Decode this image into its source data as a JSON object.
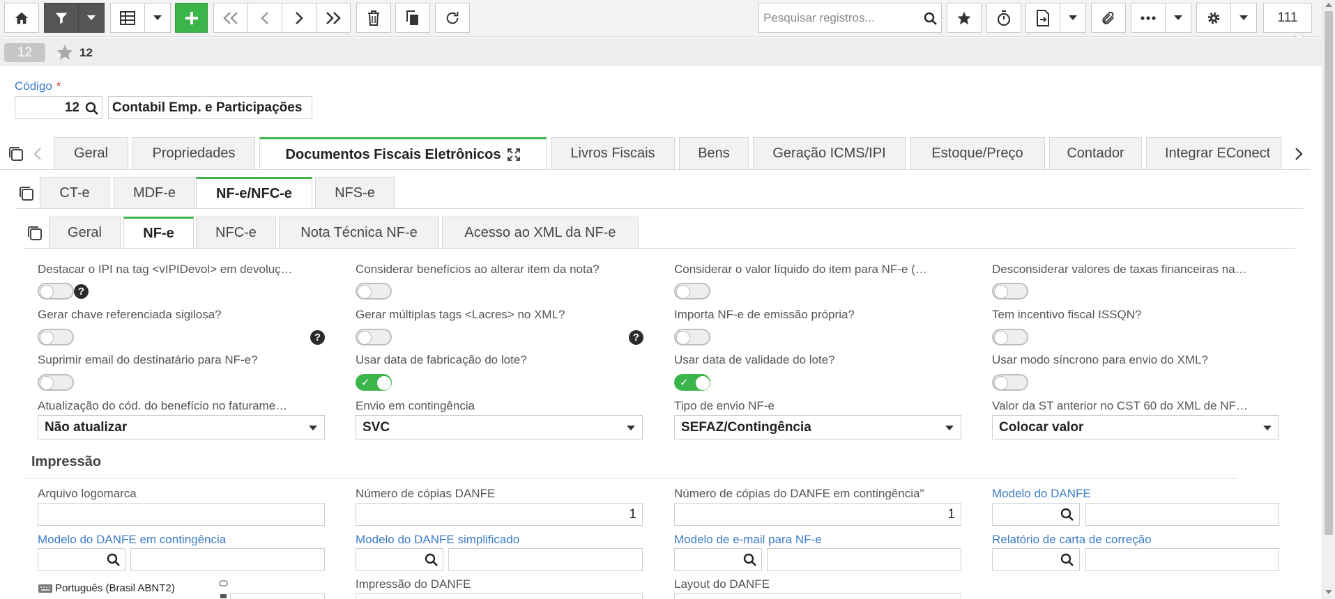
{
  "toolbar": {
    "search_placeholder": "Pesquisar registros...",
    "record_count": "111",
    "icons": [
      "home-icon",
      "filter-icon",
      "grid-icon",
      "plus-icon",
      "first-icon",
      "prev-icon",
      "next-icon",
      "last-icon",
      "trash-icon",
      "copy-icon",
      "refresh-icon",
      "search-icon",
      "star-icon",
      "timer-icon",
      "export-icon",
      "attach-icon",
      "more-icon",
      "gear-icon"
    ]
  },
  "subbar": {
    "record_badge": "12",
    "fav_number": "12"
  },
  "header": {
    "code_label": "Código",
    "code_value": "12",
    "company_name": "Contabil Emp. e Participações"
  },
  "main_tabs": [
    {
      "label": "Geral"
    },
    {
      "label": "Propriedades"
    },
    {
      "label": "Documentos Fiscais Eletrônicos",
      "active": true
    },
    {
      "label": "Livros Fiscais"
    },
    {
      "label": "Bens"
    },
    {
      "label": "Geração ICMS/IPI"
    },
    {
      "label": "Estoque/Preço"
    },
    {
      "label": "Contador"
    },
    {
      "label": "Integrar EConect"
    }
  ],
  "doc_tabs": [
    {
      "label": "CT-e"
    },
    {
      "label": "MDF-e"
    },
    {
      "label": "NF-e/NFC-e",
      "active": true
    },
    {
      "label": "NFS-e"
    }
  ],
  "nfe_tabs": [
    {
      "label": "Geral"
    },
    {
      "label": "NF-e",
      "active": true
    },
    {
      "label": "NFC-e"
    },
    {
      "label": "Nota Técnica NF-e"
    },
    {
      "label": "Acesso ao XML da NF-e"
    }
  ],
  "toggles": [
    {
      "label": "Destacar o IPI na tag <vIPIDevol> em devoluç…",
      "on": false,
      "help": true
    },
    {
      "label": "Considerar benefícios ao alterar item da nota?",
      "on": false
    },
    {
      "label": "Considerar o valor líquido do item para NF-e (…",
      "on": false
    },
    {
      "label": "Desconsiderar valores de taxas financeiras na…",
      "on": false
    },
    {
      "label": "Gerar chave referenciada sigilosa?",
      "on": false,
      "help": true
    },
    {
      "label": "Gerar múltiplas tags <Lacres> no XML?",
      "on": false,
      "help": true
    },
    {
      "label": "Importa NF-e de emissão própria?",
      "on": false
    },
    {
      "label": "Tem incentivo fiscal ISSQN?",
      "on": false
    },
    {
      "label": "Suprimir email do destinatário para NF-e?",
      "on": false
    },
    {
      "label": "Usar data de fabricação do lote?",
      "on": true
    },
    {
      "label": "Usar data de validade do lote?",
      "on": true
    },
    {
      "label": "Usar modo síncrono para envio do XML?",
      "on": false
    }
  ],
  "selects": [
    {
      "label": "Atualização do cód. do benefício no faturame…",
      "value": "Não atualizar"
    },
    {
      "label": "Envio em contingência",
      "value": "SVC"
    },
    {
      "label": "Tipo de envio NF-e",
      "value": "SEFAZ/Contingência"
    },
    {
      "label": "Valor da ST anterior no CST 60 do XML de NF…",
      "value": "Colocar valor"
    }
  ],
  "impressao": {
    "title": "Impressão",
    "logomarca_label": "Arquivo logomarca",
    "copias_label": "Número de cópias DANFE",
    "copias_value": "1",
    "copias_cont_label": "Número de cópias do DANFE em contingência\"",
    "copias_cont_value": "1",
    "modelo_danfe_label": "Modelo do DANFE",
    "modelo_cont_label": "Modelo do DANFE em contingência",
    "modelo_simpl_label": "Modelo do DANFE simplificado",
    "modelo_email_label": "Modelo de e-mail para NF-e",
    "relatorio_label": "Relatório de carta de correção",
    "impressao_label": "Impressão do DANFE",
    "layout_label": "Layout do DANFE"
  },
  "keyboard_indicator": "Português (Brasil ABNT2)"
}
